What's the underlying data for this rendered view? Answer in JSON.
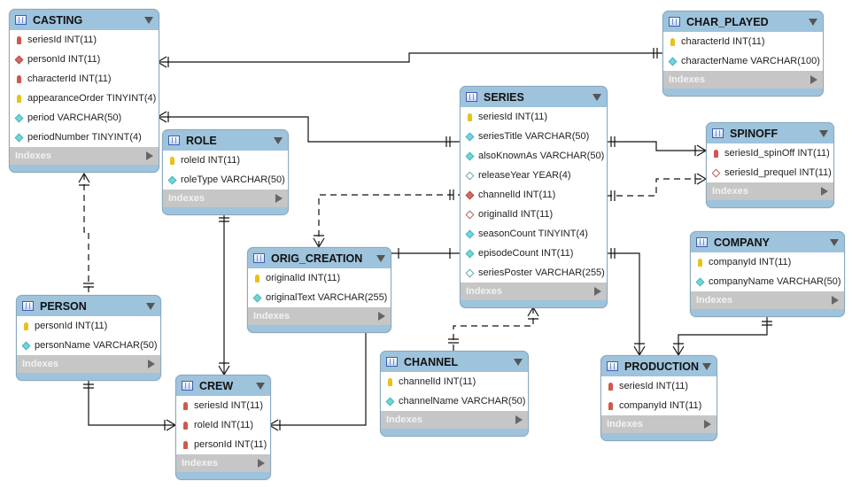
{
  "indexes_label": "Indexes",
  "tables": [
    {
      "id": "casting",
      "name": "CASTING",
      "columns": [
        {
          "icon": "fk-key",
          "text": "seriesId INT(11)"
        },
        {
          "icon": "fk-diamond",
          "text": "personId INT(11)"
        },
        {
          "icon": "fk-key",
          "text": "characterId INT(11)"
        },
        {
          "icon": "pk-key",
          "text": "appearanceOrder TINYINT(4)"
        },
        {
          "icon": "notnull-diamond",
          "text": "period VARCHAR(50)"
        },
        {
          "icon": "notnull-diamond",
          "text": "periodNumber TINYINT(4)"
        }
      ]
    },
    {
      "id": "char_played",
      "name": "CHAR_PLAYED",
      "columns": [
        {
          "icon": "pk-key",
          "text": "characterId INT(11)"
        },
        {
          "icon": "notnull-diamond",
          "text": "characterName VARCHAR(100)"
        }
      ]
    },
    {
      "id": "role",
      "name": "ROLE",
      "columns": [
        {
          "icon": "pk-key",
          "text": "roleId INT(11)"
        },
        {
          "icon": "notnull-diamond",
          "text": "roleType VARCHAR(50)"
        }
      ]
    },
    {
      "id": "series",
      "name": "SERIES",
      "columns": [
        {
          "icon": "pk-key",
          "text": "seriesId INT(11)"
        },
        {
          "icon": "notnull-diamond",
          "text": "seriesTitle VARCHAR(50)"
        },
        {
          "icon": "notnull-diamond",
          "text": "alsoKnownAs VARCHAR(50)"
        },
        {
          "icon": "nullable-diamond",
          "text": "releaseYear YEAR(4)"
        },
        {
          "icon": "fk-diamond",
          "text": "channelId INT(11)"
        },
        {
          "icon": "nullable-fk-diamond",
          "text": "originalId INT(11)"
        },
        {
          "icon": "notnull-diamond",
          "text": "seasonCount TINYINT(4)"
        },
        {
          "icon": "notnull-diamond",
          "text": "episodeCount INT(11)"
        },
        {
          "icon": "nullable-diamond",
          "text": "seriesPoster VARCHAR(255)"
        }
      ]
    },
    {
      "id": "spinoff",
      "name": "SPINOFF",
      "columns": [
        {
          "icon": "fk-key",
          "text": "seriesId_spinOff INT(11)"
        },
        {
          "icon": "nullable-fk-diamond",
          "text": "seriesId_prequel INT(11)"
        }
      ]
    },
    {
      "id": "orig_creation",
      "name": "ORIG_CREATION",
      "columns": [
        {
          "icon": "pk-key",
          "text": "originalId INT(11)"
        },
        {
          "icon": "notnull-diamond",
          "text": "originalText VARCHAR(255)"
        }
      ]
    },
    {
      "id": "company",
      "name": "COMPANY",
      "columns": [
        {
          "icon": "pk-key",
          "text": "companyId INT(11)"
        },
        {
          "icon": "notnull-diamond",
          "text": "companyName VARCHAR(50)"
        }
      ]
    },
    {
      "id": "person",
      "name": "PERSON",
      "columns": [
        {
          "icon": "pk-key",
          "text": "personId INT(11)"
        },
        {
          "icon": "notnull-diamond",
          "text": "personName VARCHAR(50)"
        }
      ]
    },
    {
      "id": "channel",
      "name": "CHANNEL",
      "columns": [
        {
          "icon": "pk-key",
          "text": "channelId INT(11)"
        },
        {
          "icon": "notnull-diamond",
          "text": "channelName VARCHAR(50)"
        }
      ]
    },
    {
      "id": "production",
      "name": "PRODUCTION",
      "columns": [
        {
          "icon": "fk-key",
          "text": "seriesId INT(11)"
        },
        {
          "icon": "fk-key",
          "text": "companyId INT(11)"
        }
      ]
    },
    {
      "id": "crew",
      "name": "CREW",
      "columns": [
        {
          "icon": "fk-key",
          "text": "seriesId INT(11)"
        },
        {
          "icon": "fk-key",
          "text": "roleId INT(11)"
        },
        {
          "icon": "fk-key",
          "text": "personId INT(11)"
        }
      ]
    }
  ],
  "colors": {
    "header": "#9ec3dc",
    "indexes": "#c6c6c6",
    "pk": "#e8c21a",
    "fk": "#d0584c",
    "notnull": "#6fd6da"
  }
}
